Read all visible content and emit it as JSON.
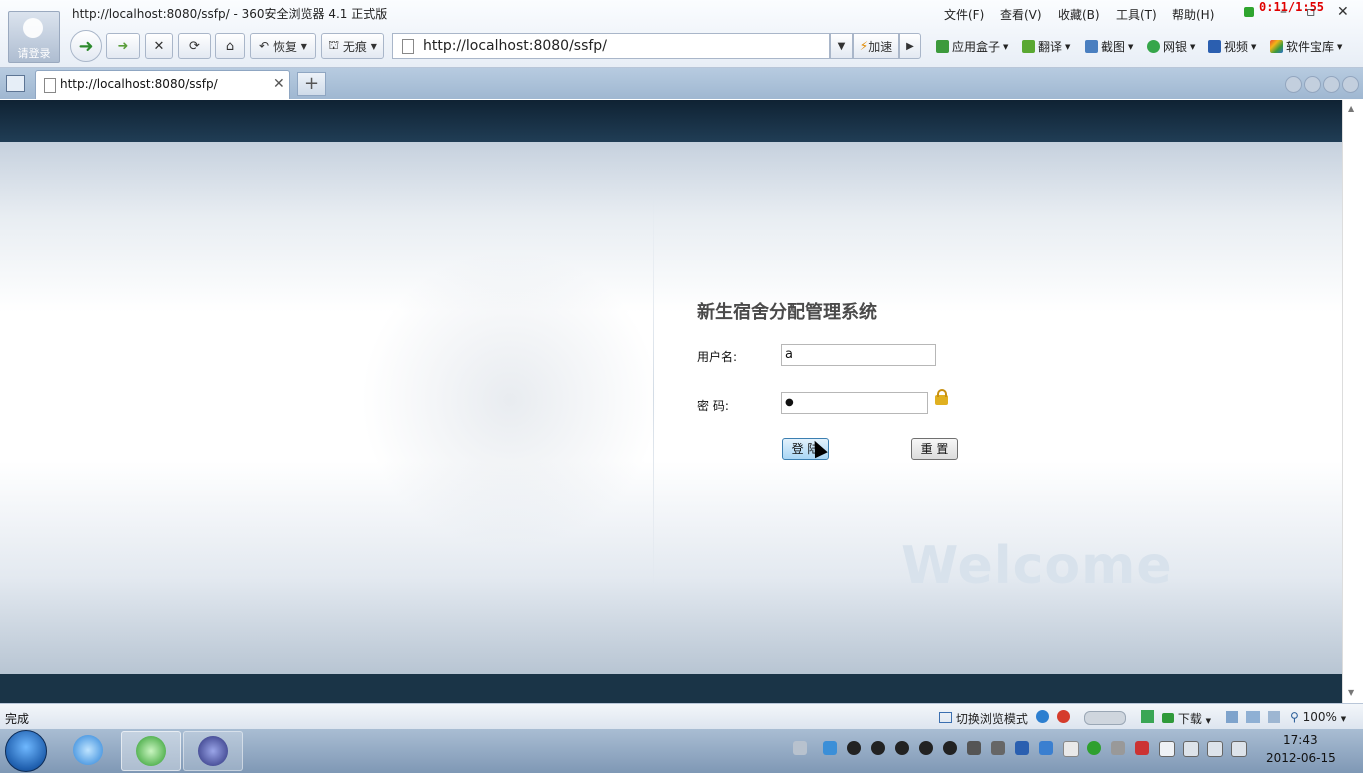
{
  "window": {
    "title": "http://localhost:8080/ssfp/ - 360安全浏览器 4.1 正式版",
    "login_label": "请登录",
    "timer": "0:11/1:55",
    "menu": [
      "文件(F)",
      "查看(V)",
      "收藏(B)",
      "工具(T)",
      "帮助(H)"
    ]
  },
  "toolbar": {
    "restore_label": "恢复",
    "private_label": "无痕",
    "address": "http://localhost:8080/ssfp/",
    "speedup_label": "加速",
    "bookmarks": [
      "应用盒子",
      "翻译",
      "截图",
      "网银",
      "视频",
      "软件宝库"
    ]
  },
  "tab": {
    "title": "http://localhost:8080/ssfp/"
  },
  "page": {
    "system_title": "新生宿舍分配管理系统",
    "username_label": "用户名:",
    "username_value": "a",
    "password_label": "密 码:",
    "password_value": "●",
    "login_button": "登 陆",
    "reset_button": "重 置",
    "welcome_text": "Welcome"
  },
  "statusbar": {
    "status": "完成",
    "mode_switch": "切换浏览模式",
    "download": "下载",
    "zoom": "100%"
  },
  "taskbar": {
    "time": "17:43",
    "date": "2012-06-15"
  },
  "colors": {
    "header_band": "#1a3447",
    "login_button_bg": "#a9d6f5",
    "timer": "#e00000"
  }
}
